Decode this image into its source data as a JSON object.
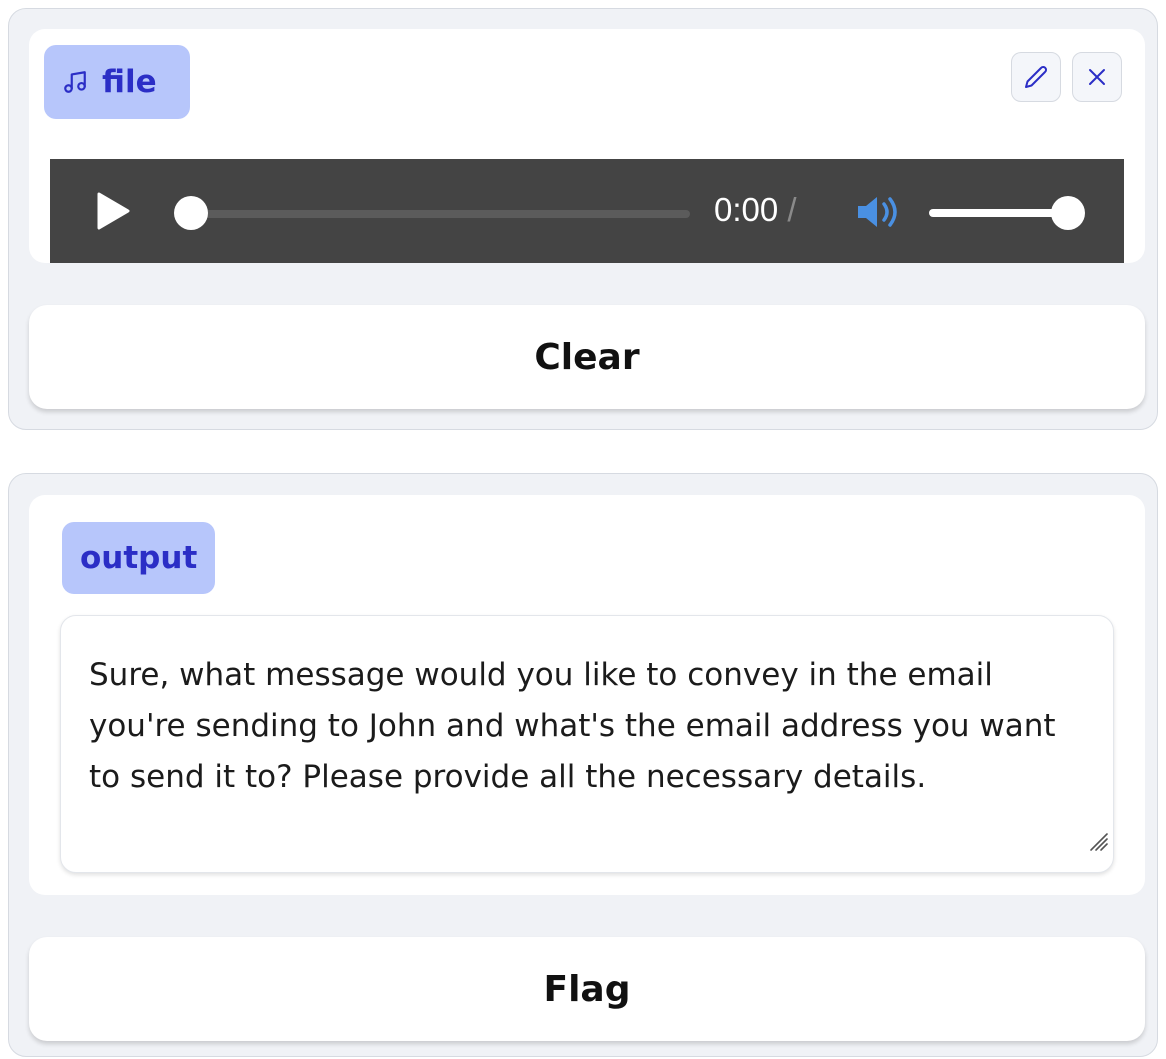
{
  "input_panel": {
    "label": "file",
    "label_icon": "music-note-icon",
    "edit_icon": "pencil-icon",
    "close_icon": "close-icon",
    "player": {
      "play_icon": "play-icon",
      "time": "0:00",
      "separator": "/",
      "volume_icon": "volume-icon",
      "progress": 0,
      "volume": 1
    },
    "clear_label": "Clear"
  },
  "output_panel": {
    "label": "output",
    "text": "Sure, what message would you like to convey in the email you're sending to John and what's the email address you want to send it to? Please provide all the necessary details.",
    "flag_label": "Flag"
  },
  "colors": {
    "accent_text": "#2b2ec6",
    "label_bg": "#b7c6fb",
    "player_bg": "#444444",
    "volume_icon": "#4a90e2",
    "panel_bg": "#f0f2f6"
  }
}
